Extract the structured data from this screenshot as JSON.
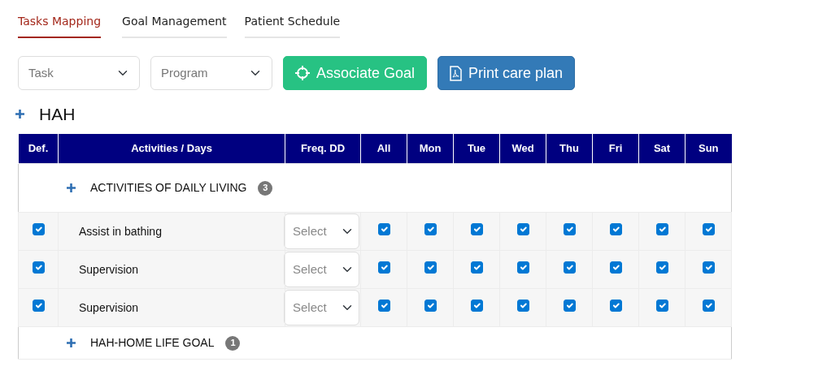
{
  "tabs": [
    {
      "label": "Tasks Mapping",
      "selected": true
    },
    {
      "label": "Goal Management",
      "selected": false
    },
    {
      "label": "Patient Schedule",
      "selected": false
    }
  ],
  "filters": [
    {
      "placeholder": "Task"
    },
    {
      "placeholder": "Program"
    }
  ],
  "buttons": [
    {
      "label": "Associate Goal",
      "kind": "associate"
    },
    {
      "label": "Print care plan",
      "kind": "print"
    }
  ],
  "section": {
    "title": "HAH"
  },
  "table": {
    "columns": [
      "Def.",
      "Activities / Days",
      "Freq. DD",
      "All",
      "Mon",
      "Tue",
      "Wed",
      "Thu",
      "Fri",
      "Sat",
      "Sun"
    ],
    "groups": [
      {
        "title": "ACTIVITIES OF DAILY LIVING",
        "count": "3",
        "tasks": [
          {
            "name": "Assist in bathing",
            "default": true,
            "frequency": {
              "placeholder": "Select"
            },
            "days": [
              true,
              true,
              true,
              true,
              true,
              true,
              true,
              true
            ]
          },
          {
            "name": "Supervision",
            "default": true,
            "frequency": {
              "placeholder": "Select"
            },
            "days": [
              true,
              true,
              true,
              true,
              true,
              true,
              true,
              true
            ]
          },
          {
            "name": "Supervision",
            "default": true,
            "frequency": {
              "placeholder": "Select"
            },
            "days": [
              true,
              true,
              true,
              true,
              true,
              true,
              true,
              true
            ]
          }
        ]
      },
      {
        "title": "HAH-HOME LIFE GOAL",
        "count": "1"
      }
    ]
  }
}
